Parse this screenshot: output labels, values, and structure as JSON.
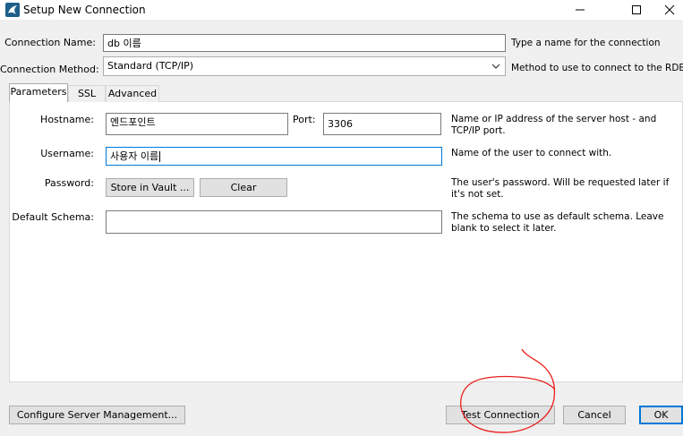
{
  "window": {
    "title": "Setup New Connection",
    "icons": [
      "mysql-workbench-icon",
      "minimize-icon",
      "maximize-icon",
      "close-icon"
    ]
  },
  "connection_name": {
    "label": "Connection Name:",
    "value": "db 이름",
    "help": "Type a name for the connection"
  },
  "connection_method": {
    "label": "Connection Method:",
    "value": "Standard (TCP/IP)",
    "help": "Method to use to connect to the RDBMS"
  },
  "tabs": [
    {
      "label": "Parameters",
      "active": true
    },
    {
      "label": "SSL",
      "active": false
    },
    {
      "label": "Advanced",
      "active": false
    }
  ],
  "parameters": {
    "hostname": {
      "label": "Hostname:",
      "value": "엔드포인트",
      "help": "Name or IP address of the server host - and TCP/IP port."
    },
    "port": {
      "label": "Port:",
      "value": "3306"
    },
    "username": {
      "label": "Username:",
      "value": "사용자 이름",
      "help": "Name of the user to connect with."
    },
    "password": {
      "label": "Password:",
      "store_button": "Store in Vault ...",
      "clear_button": "Clear",
      "help": "The user's password. Will be requested later if it's not set."
    },
    "default_schema": {
      "label": "Default Schema:",
      "value": "",
      "help": "The schema to use as default schema. Leave blank to select it later."
    }
  },
  "buttons": {
    "configure": "Configure Server Management...",
    "test": "Test Connection",
    "cancel": "Cancel",
    "ok": "OK"
  },
  "colors": {
    "focus_border": "#0078d7",
    "annotation_circle": "#e8201c"
  }
}
